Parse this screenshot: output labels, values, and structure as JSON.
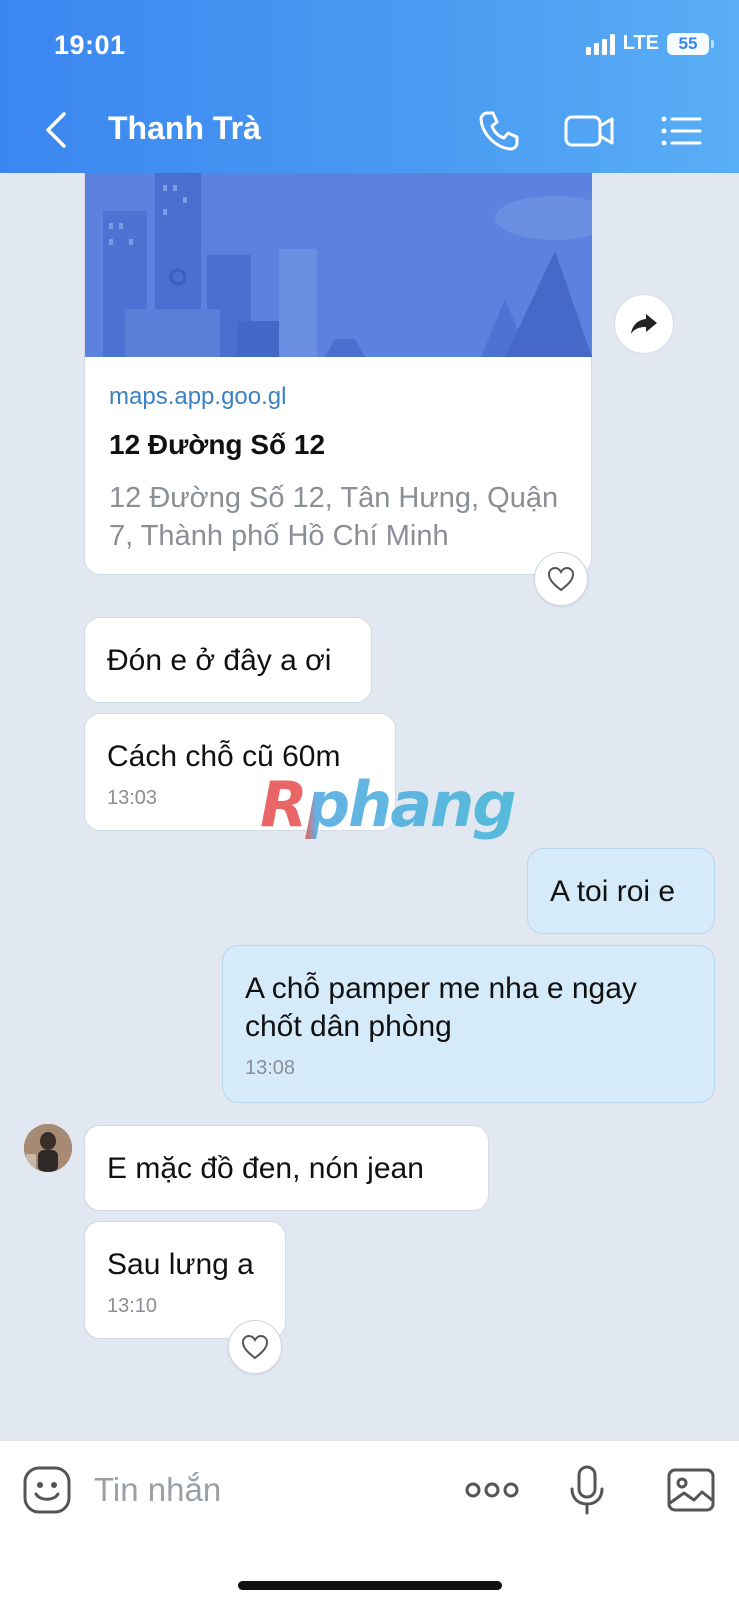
{
  "status_bar": {
    "time": "19:01",
    "network": "LTE",
    "battery": "55"
  },
  "header": {
    "title": "Thanh Trà"
  },
  "link_card": {
    "domain": "maps.app.goo.gl",
    "title": "12 Đường Số 12",
    "description": "12 Đường Số 12, Tân Hưng, Quận 7, Thành phố Hồ Chí Minh"
  },
  "messages": [
    {
      "side": "in",
      "text": "Đón e ở đây a ơi",
      "time": ""
    },
    {
      "side": "in",
      "text": "Cách chỗ cũ 60m",
      "time": "13:03"
    },
    {
      "side": "out",
      "text": "A toi roi e",
      "time": ""
    },
    {
      "side": "out",
      "text": "A chỗ pamper me nha e ngay chốt dân phòng",
      "time": "13:08"
    },
    {
      "side": "in",
      "text": "E mặc đồ đen, nón jean",
      "time": ""
    },
    {
      "side": "in",
      "text": "Sau lưng a",
      "time": "13:10"
    }
  ],
  "watermark": "Rphang",
  "input": {
    "placeholder": "Tin nhắn"
  },
  "icons": {
    "back": "chevron-left-icon",
    "call": "phone-icon",
    "video": "video-camera-icon",
    "menu": "list-menu-icon",
    "share": "share-arrow-icon",
    "react": "heart-icon",
    "emoji": "sticker-icon",
    "more": "more-dots-icon",
    "mic": "microphone-icon",
    "gallery": "image-icon"
  },
  "colors": {
    "header": "#3b86f0",
    "outgoing_bubble": "#d6ebfa",
    "incoming_bubble": "#ffffff",
    "background": "#e2e8f1",
    "link": "#3b82c4"
  }
}
